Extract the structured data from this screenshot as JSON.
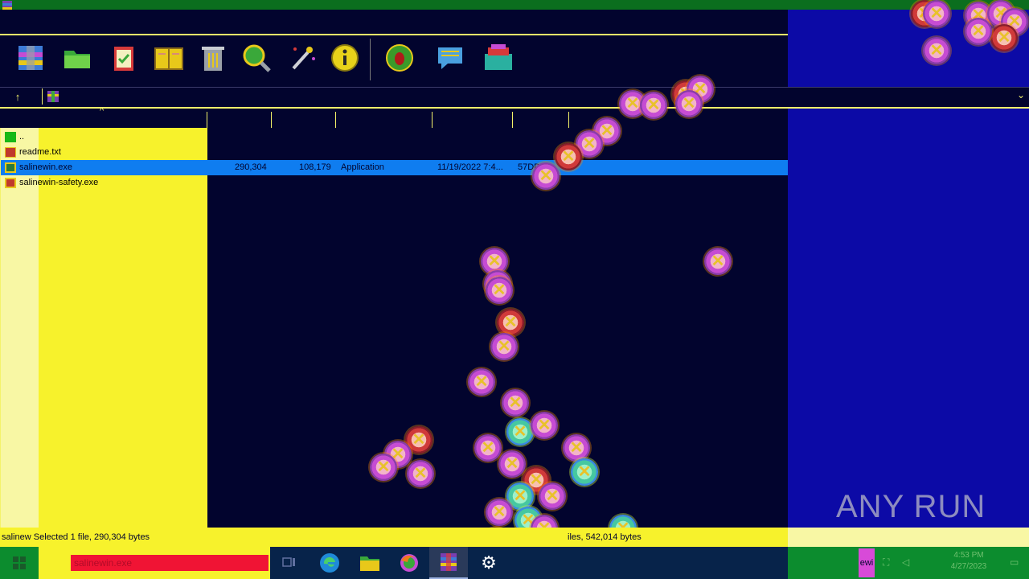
{
  "toolbar": {
    "buttons": [
      {
        "name": "add-button",
        "icon": "add-archive-icon",
        "color": "#3d7bd6"
      },
      {
        "name": "extract-to-button",
        "icon": "folder-extract-icon",
        "color": "#3aa83a"
      },
      {
        "name": "test-button",
        "icon": "clipboard-check-icon",
        "color": "#d63a3a"
      },
      {
        "name": "view-button",
        "icon": "book-view-icon",
        "color": "#e8c81a"
      },
      {
        "name": "delete-button",
        "icon": "trash-icon",
        "color": "#9aa0a8"
      },
      {
        "name": "find-button",
        "icon": "magnifier-icon",
        "color": "#3aa83a"
      },
      {
        "name": "wizard-button",
        "icon": "magic-wand-icon",
        "color": "#cfd0d6"
      },
      {
        "name": "info-button",
        "icon": "info-icon",
        "color": "#e8d21a"
      },
      {
        "name": "virus-scan-button",
        "icon": "shield-bug-icon",
        "color": "#3a9a2a"
      },
      {
        "name": "comment-button",
        "icon": "comment-icon",
        "color": "#4aa0e0"
      },
      {
        "name": "sfx-button",
        "icon": "sfx-archive-icon",
        "color": "#2ab0a0"
      }
    ]
  },
  "address": {
    "up_icon": "up-arrow-icon",
    "dropdown_icon": "chevron-down-icon"
  },
  "files": [
    {
      "name": "..",
      "icon_color": "#16b816"
    },
    {
      "name": "readme.txt",
      "icon_color": "#c0392b"
    },
    {
      "name": "salinewin.exe",
      "size": "290,304",
      "packed": "108,179",
      "type": "Application",
      "modified": "11/19/2022 7:4...",
      "crc": "57DD...",
      "icon_color": "#2b7a3a",
      "selected": true
    },
    {
      "name": "salinewin-safety.exe",
      "icon_color": "#c0392b"
    }
  ],
  "status": {
    "left": "salinew Selected 1 file, 290,304 bytes",
    "right": "iles, 542,014 bytes"
  },
  "taskbar": {
    "search_text": "salinewin.exe",
    "apps": [
      {
        "name": "task-view-button",
        "icon": "task-view-icon"
      },
      {
        "name": "edge-button",
        "icon": "edge-icon"
      },
      {
        "name": "file-explorer-button",
        "icon": "folder-icon"
      },
      {
        "name": "firefox-button",
        "icon": "firefox-icon"
      },
      {
        "name": "winrar-button",
        "icon": "winrar-icon"
      },
      {
        "name": "settings-button",
        "icon": "gear-icon"
      }
    ],
    "tray_lang": "ewi",
    "clock_time": "4:53 PM",
    "clock_date": "4/27/2023"
  },
  "watermark": "ANY RUN",
  "colors": {
    "background": "#02042e",
    "name_column": "#f7f22c",
    "selection": "#0f7df0",
    "right_panel": "#0c0aa6",
    "taskbar": "#07234a"
  }
}
